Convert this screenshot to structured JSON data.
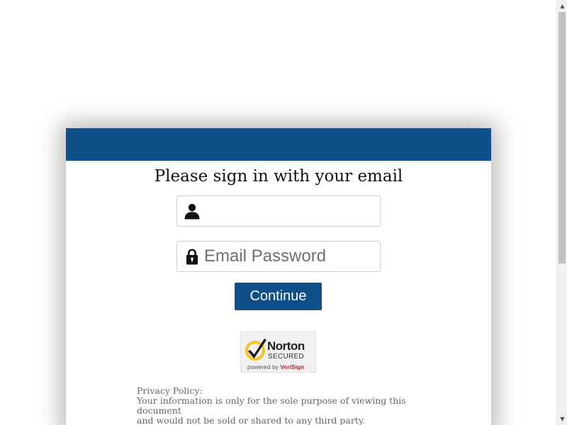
{
  "colors": {
    "header": "#0f4f8a",
    "button": "#0f4f8a"
  },
  "form": {
    "title": "Please sign in with your email",
    "email": {
      "icon": "user-icon",
      "value": "",
      "placeholder": ""
    },
    "password": {
      "icon": "lock-icon",
      "value": "",
      "placeholder": "Email Password"
    },
    "continue_label": "Continue"
  },
  "badge": {
    "brand": "Norton",
    "secured": "SECURED",
    "powered_by": "powered by",
    "verisign": "VeriSign"
  },
  "privacy": {
    "heading": "Privacy Policy:",
    "line1": "Your information is only for the sole purpose of viewing this document",
    "line2": "and would not be sold or shared to any third party."
  },
  "scrollbar": {
    "up_icon": "scroll-up-arrow",
    "down_icon": "scroll-down-arrow"
  }
}
